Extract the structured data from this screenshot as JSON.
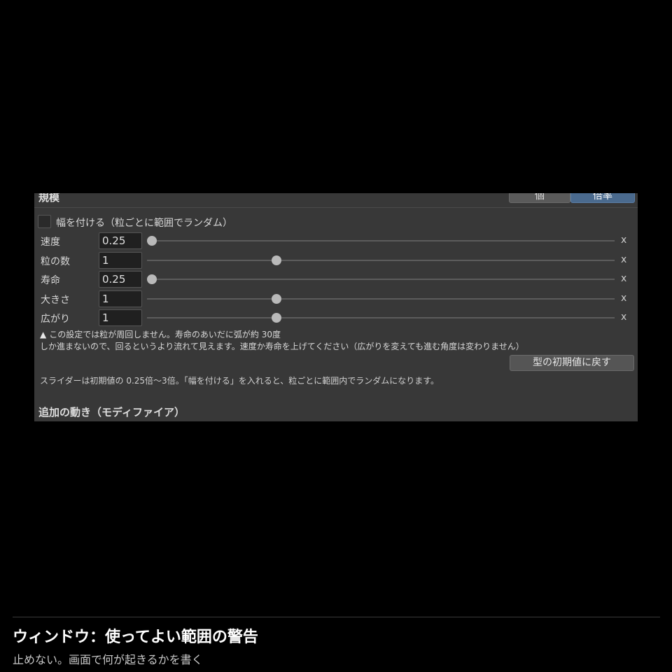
{
  "section": {
    "title": "規模",
    "segments": [
      {
        "label": "個",
        "active": false
      },
      {
        "label": "倍率",
        "active": true
      }
    ]
  },
  "spread_checkbox": {
    "label": "幅を付ける（粒ごとに範囲でランダム）",
    "checked": false
  },
  "sliders": [
    {
      "label": "速度",
      "value": "0.25",
      "position_fraction": 0.0,
      "unit": "x"
    },
    {
      "label": "粒の数",
      "value": "1",
      "position_fraction": 0.2727,
      "unit": "x"
    },
    {
      "label": "寿命",
      "value": "0.25",
      "position_fraction": 0.0,
      "unit": "x"
    },
    {
      "label": "大きさ",
      "value": "1",
      "position_fraction": 0.2727,
      "unit": "x"
    },
    {
      "label": "広がり",
      "value": "1",
      "position_fraction": 0.2727,
      "unit": "x"
    }
  ],
  "warning": {
    "line1": "この設定では粒が周回しません。寿命のあいだに弧が約 30度",
    "line2": "しか進まないので、回るというより流れて見えます。速度か寿命を上げてください（広がりを変えても進む角度は変わりません）"
  },
  "reset_button_label": "型の初期値に戻す",
  "hint": "スライダーは初期値の 0.25倍～3倍。「幅を付ける」を入れると、粒ごとに範囲内でランダムになります。",
  "modifier_section_title": "追加の動き（モディファイア）",
  "caption": {
    "title": "ウィンドウ：使ってよい範囲の警告",
    "subtitle": "止めない。画面で何が起きるかを書く"
  },
  "colors": {
    "panel_bg": "#383838",
    "accent": "#4a6a8e",
    "thumb": "#b9b9b9"
  },
  "icons": {
    "warning": "warning-triangle-icon"
  }
}
